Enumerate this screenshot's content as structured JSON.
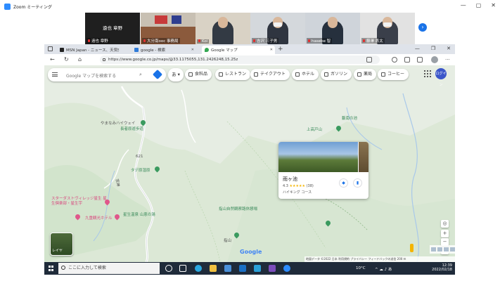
{
  "zoom": {
    "title": "Zoom ミーティング",
    "participants": [
      {
        "name": "遠也 章野",
        "video": false
      },
      {
        "name": "大分南ooc 事務局",
        "video": true
      },
      {
        "name": "Koi",
        "video": true
      },
      {
        "name": "吉沢 三子男",
        "video": true
      },
      {
        "name": "hasebe 智",
        "video": true
      },
      {
        "name": "藤澤 恵太",
        "video": true
      }
    ],
    "big_name": "遠也 章野"
  },
  "browser": {
    "tabs": [
      {
        "label": "MSN Japan - ニュース、天気、メール",
        "active": false
      },
      {
        "label": "google - 検索",
        "active": false
      },
      {
        "label": "Google マップ",
        "active": true
      }
    ],
    "url": "https://www.google.co.jp/maps/@33.1175055,131.2426248,15.25z"
  },
  "maps": {
    "search_placeholder": "Google マップを検索する",
    "language": "あ",
    "chips": [
      "食料品",
      "レストラン",
      "テイクアウト",
      "ホテル",
      "ガソリン",
      "薬局",
      "コーヒー"
    ],
    "login": "ログイン",
    "labels": {
      "yamanami": "やまなみハイウェイ",
      "nagakawa": "長者原遊歩道",
      "uesayuri": "上高戸山",
      "suikou": "藪南の池",
      "tade": "タデ原湿原",
      "stardust": "スターダストヴィレッジ星生 星生倶楽部・星生宇",
      "route": "621",
      "kuju_kanko": "九重観光ホテル",
      "hoshio_onsen": "星生温泉 山恵の湯",
      "kuju_mt": "指山自然観察路休憩場",
      "sashiyama": "指山",
      "side_road": "宮神"
    },
    "place": {
      "name": "雨ヶ池",
      "rating": "4.3",
      "stars": "★★★★★",
      "reviews": "(38)",
      "type": "ハイキング コース"
    },
    "layers_label": "レイヤ",
    "google_logo": "Google",
    "footer": "地図データ ©2022   日本   利用規約   プライバシー   フィードバックの送信   200 m"
  },
  "taskbar": {
    "search_placeholder": "ここに入力して検索",
    "temperature": "10°C",
    "time": "12:39",
    "date": "2022/02/18"
  }
}
